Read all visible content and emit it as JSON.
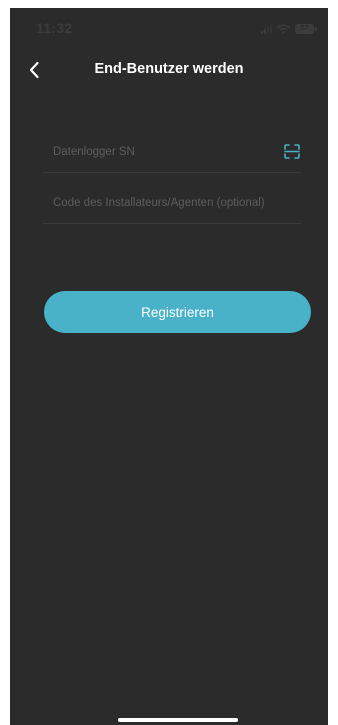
{
  "status_bar": {
    "time": "11:32",
    "battery_level": "57"
  },
  "header": {
    "title": "End-Benutzer werden",
    "back_icon": "chevron-left-icon"
  },
  "form": {
    "datalogger_sn": {
      "placeholder": "Datenlogger SN",
      "value": "",
      "scan_icon": "scan-icon"
    },
    "installer_code": {
      "placeholder": "Code des Installateurs/Agenten (optional)",
      "value": ""
    }
  },
  "register_button": {
    "label": "Registrieren"
  },
  "colors": {
    "background": "#2b2b2b",
    "accent": "#4ab2c8",
    "title": "#ffffff",
    "placeholder": "#5d5d5d"
  }
}
